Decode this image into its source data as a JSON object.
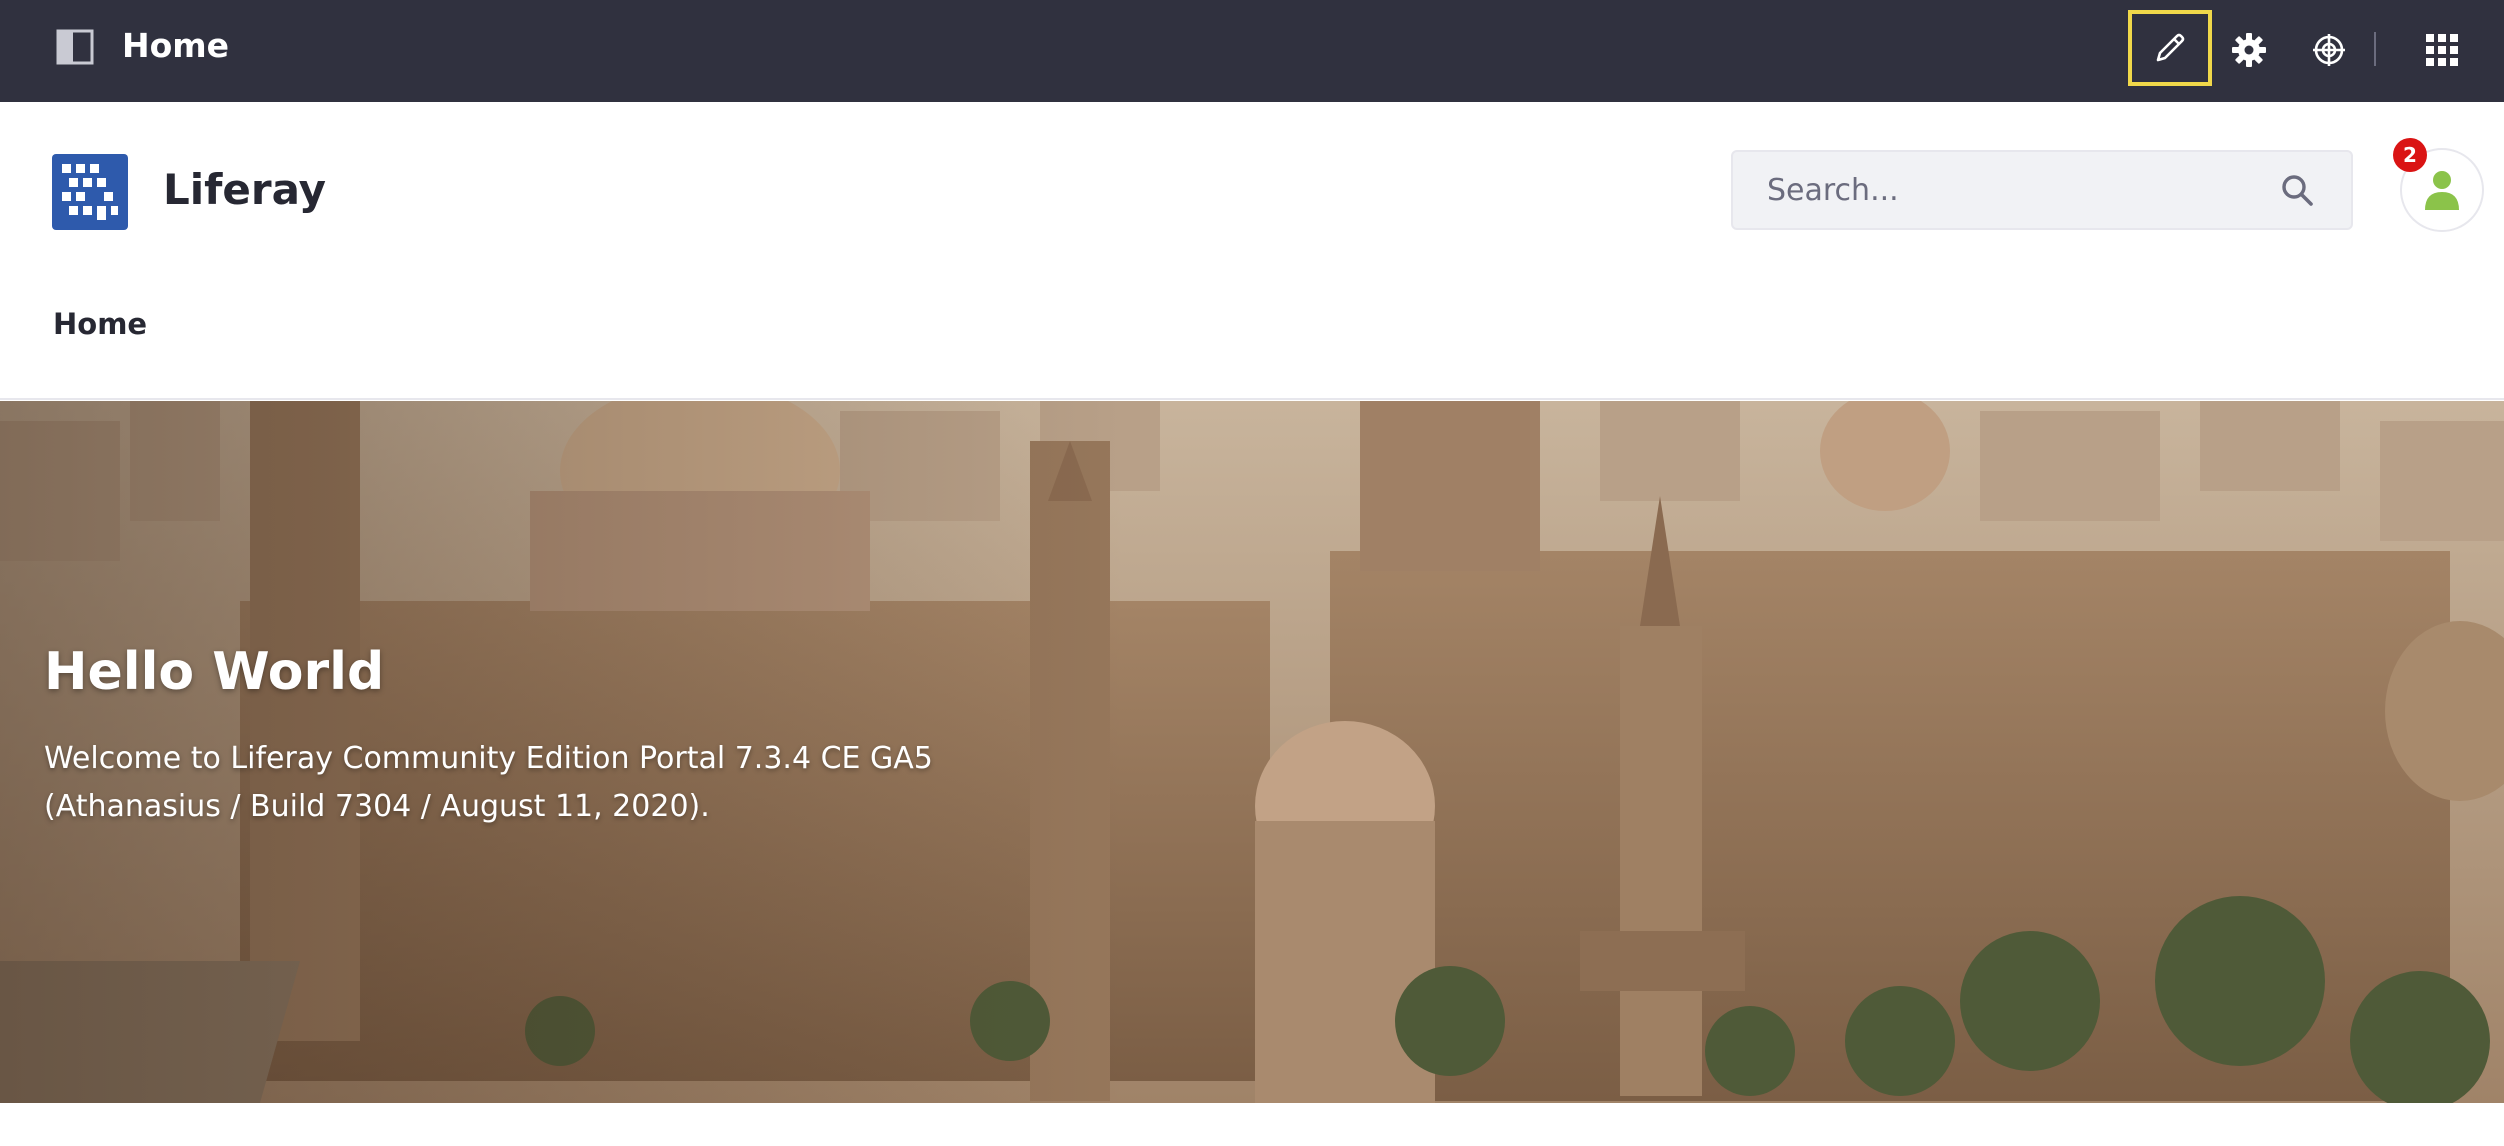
{
  "control_bar": {
    "title": "Home",
    "icons": {
      "toggle": "product-menu-icon",
      "edit": "pencil-icon",
      "settings": "gear-icon",
      "simulation": "simulation-target-icon",
      "apps": "apps-grid-icon"
    },
    "colors": {
      "background": "#30313f",
      "edit_highlight": "#f0d84a"
    }
  },
  "site": {
    "name": "Liferay",
    "logo_color": "#2e5aac"
  },
  "search": {
    "placeholder": "Search...",
    "value": ""
  },
  "user": {
    "notification_count": "2",
    "avatar_color": "#8bc34a",
    "badge_color": "#da1414"
  },
  "nav": {
    "items": [
      {
        "label": "Home"
      }
    ]
  },
  "banner": {
    "title": "Hello World",
    "line1": "Welcome to Liferay Community Edition Portal 7.3.4 CE GA5",
    "line2": "(Athanasius / Build 7304 / August 11, 2020)."
  }
}
